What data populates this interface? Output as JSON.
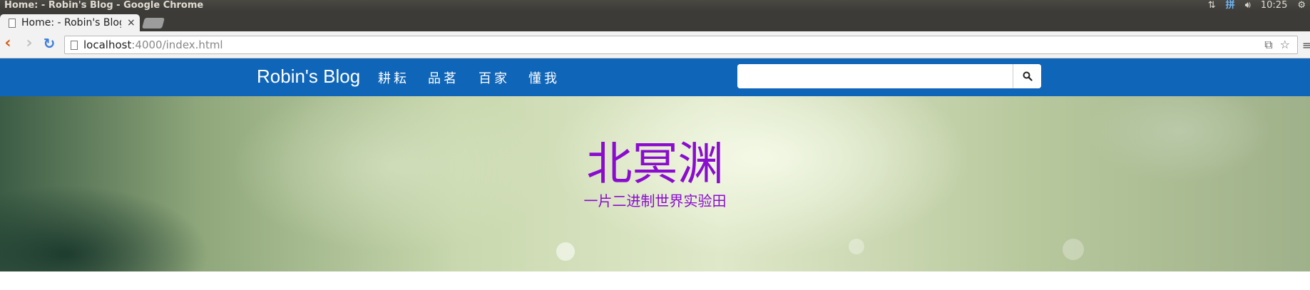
{
  "os": {
    "window_title": "Home: - Robin's Blog - Google Chrome",
    "ime_label": "拼",
    "time": "10:25"
  },
  "browser": {
    "tab_title": "Home: - Robin's Blog",
    "tab_close": "×",
    "url_host": "localhost",
    "url_path": ":4000/index.html",
    "back_glyph": "‹",
    "forward_glyph": "›",
    "reload_glyph": "↻",
    "menu_glyph": "≡"
  },
  "site": {
    "brand": "Robin's Blog",
    "nav": [
      "耕耘",
      "品茗",
      "百家",
      "懂我"
    ],
    "search": {
      "value": "",
      "placeholder": ""
    }
  },
  "hero": {
    "title": "北冥渊",
    "subtitle": "一片二进制世界实验田"
  },
  "colors": {
    "navbar": "#0f65b8",
    "hero_text": "#8a0ccf"
  },
  "icons": {
    "search": "magnifier-icon",
    "bookmark": "star-icon",
    "translate": "translate-icon"
  }
}
